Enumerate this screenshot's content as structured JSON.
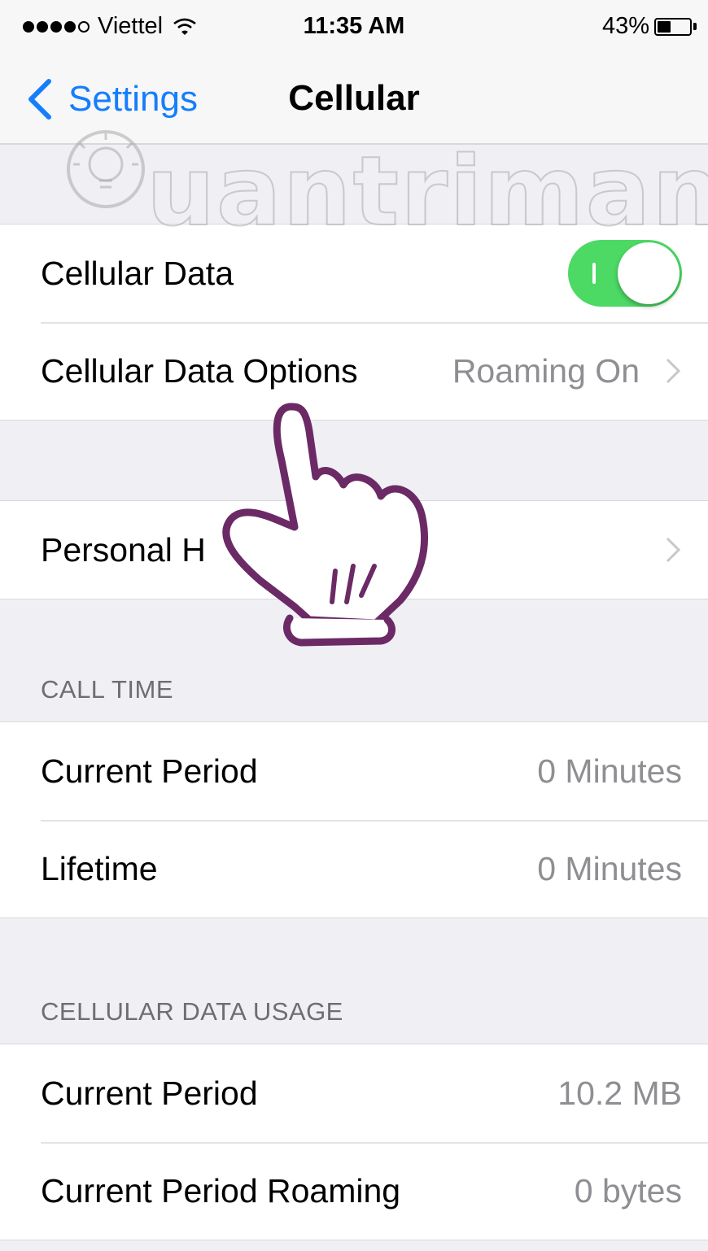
{
  "status_bar": {
    "carrier": "Viettel",
    "signal_strength": 4,
    "signal_max": 5,
    "time": "11:35 AM",
    "battery_percent": "43%",
    "icons": [
      "signal-dots-icon",
      "wifi-icon",
      "battery-icon"
    ]
  },
  "nav": {
    "back_label": "Settings",
    "title": "Cellular",
    "accent": "#157efb"
  },
  "group1": {
    "cellular_data": {
      "label": "Cellular Data",
      "toggle_on": true,
      "toggle_color": "#4cd964"
    },
    "data_options": {
      "label": "Cellular Data Options",
      "value": "Roaming On"
    }
  },
  "group2": {
    "personal_hotspot": {
      "label": "Personal H"
    }
  },
  "call_time": {
    "header": "CALL TIME",
    "current_period": {
      "label": "Current Period",
      "value": "0 Minutes"
    },
    "lifetime": {
      "label": "Lifetime",
      "value": "0 Minutes"
    }
  },
  "data_usage": {
    "header": "CELLULAR DATA USAGE",
    "current_period": {
      "label": "Current Period",
      "value": "10.2 MB"
    },
    "current_period_roaming": {
      "label": "Current Period Roaming",
      "value": "0 bytes"
    }
  },
  "overlay": {
    "watermark": "uantrimang",
    "icons": [
      "lightbulb-watermark-icon",
      "hand-pointer-icon"
    ]
  }
}
